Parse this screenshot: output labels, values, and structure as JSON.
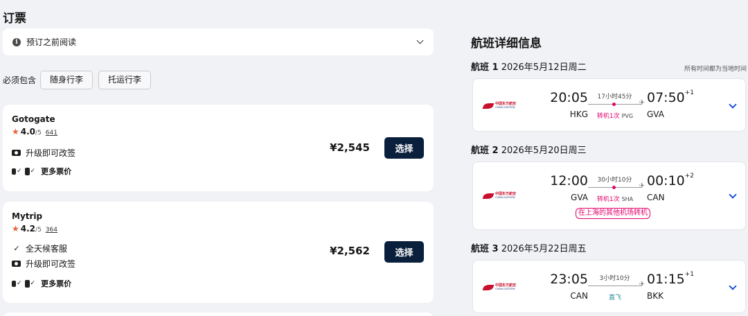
{
  "booking": {
    "title": "订票",
    "notice_label": "预订之前阅读",
    "must_include_label": "必须包含",
    "chips": [
      "随身行李",
      "托运行李"
    ]
  },
  "offers": [
    {
      "agent": "Gotogate",
      "rating": "4.0",
      "rating_max": "/5",
      "reviews": "641",
      "features": [
        "升级即可改签"
      ],
      "more_fares": "更多票价",
      "price": "¥2,545",
      "select_label": "选择"
    },
    {
      "agent": "Mytrip",
      "rating": "4.2",
      "rating_max": "/5",
      "reviews": "364",
      "features": [
        "全天候客服",
        "升级即可改签"
      ],
      "more_fares": "更多票价",
      "price": "¥2,562",
      "select_label": "选择"
    }
  ],
  "details": {
    "title": "航班详细信息",
    "local_time_note": "所有时间都为当地时间",
    "airline": {
      "name_cn": "中国东方航空",
      "name_en": "CHINA EASTERN"
    },
    "segments": [
      {
        "label": "航班 1",
        "date": "2026年5月12日周二",
        "dep_time": "20:05",
        "dep_code": "HKG",
        "arr_time": "07:50",
        "arr_plus": "+1",
        "arr_code": "GVA",
        "duration": "17小时45分",
        "stops": "转机1次",
        "via": "PVG",
        "alert": ""
      },
      {
        "label": "航班 2",
        "date": "2026年5月20日周三",
        "dep_time": "12:00",
        "dep_code": "GVA",
        "arr_time": "00:10",
        "arr_plus": "+2",
        "arr_code": "CAN",
        "duration": "30小时10分",
        "stops": "转机1次",
        "via": "SHA",
        "alert": "在上海的其他机场转机"
      },
      {
        "label": "航班 3",
        "date": "2026年5月22日周五",
        "dep_time": "23:05",
        "dep_code": "CAN",
        "arr_time": "01:15",
        "arr_plus": "+1",
        "arr_code": "BKK",
        "duration": "3小时10分",
        "stops": "直飞",
        "via": "",
        "alert": ""
      }
    ]
  },
  "colors": {
    "primary_button": "#0a1f3c",
    "stop_accent": "#e5006a",
    "direct_accent": "#1a8a9a",
    "rating_star": "#e8603c",
    "expand_chevron": "#1b4fd6"
  },
  "icons": [
    "info-icon",
    "chevron-down-icon",
    "star-icon",
    "phone-icon",
    "check-icon",
    "carry-on-bag-icon",
    "checked-bag-icon",
    "plane-icon",
    "airline-logo"
  ]
}
